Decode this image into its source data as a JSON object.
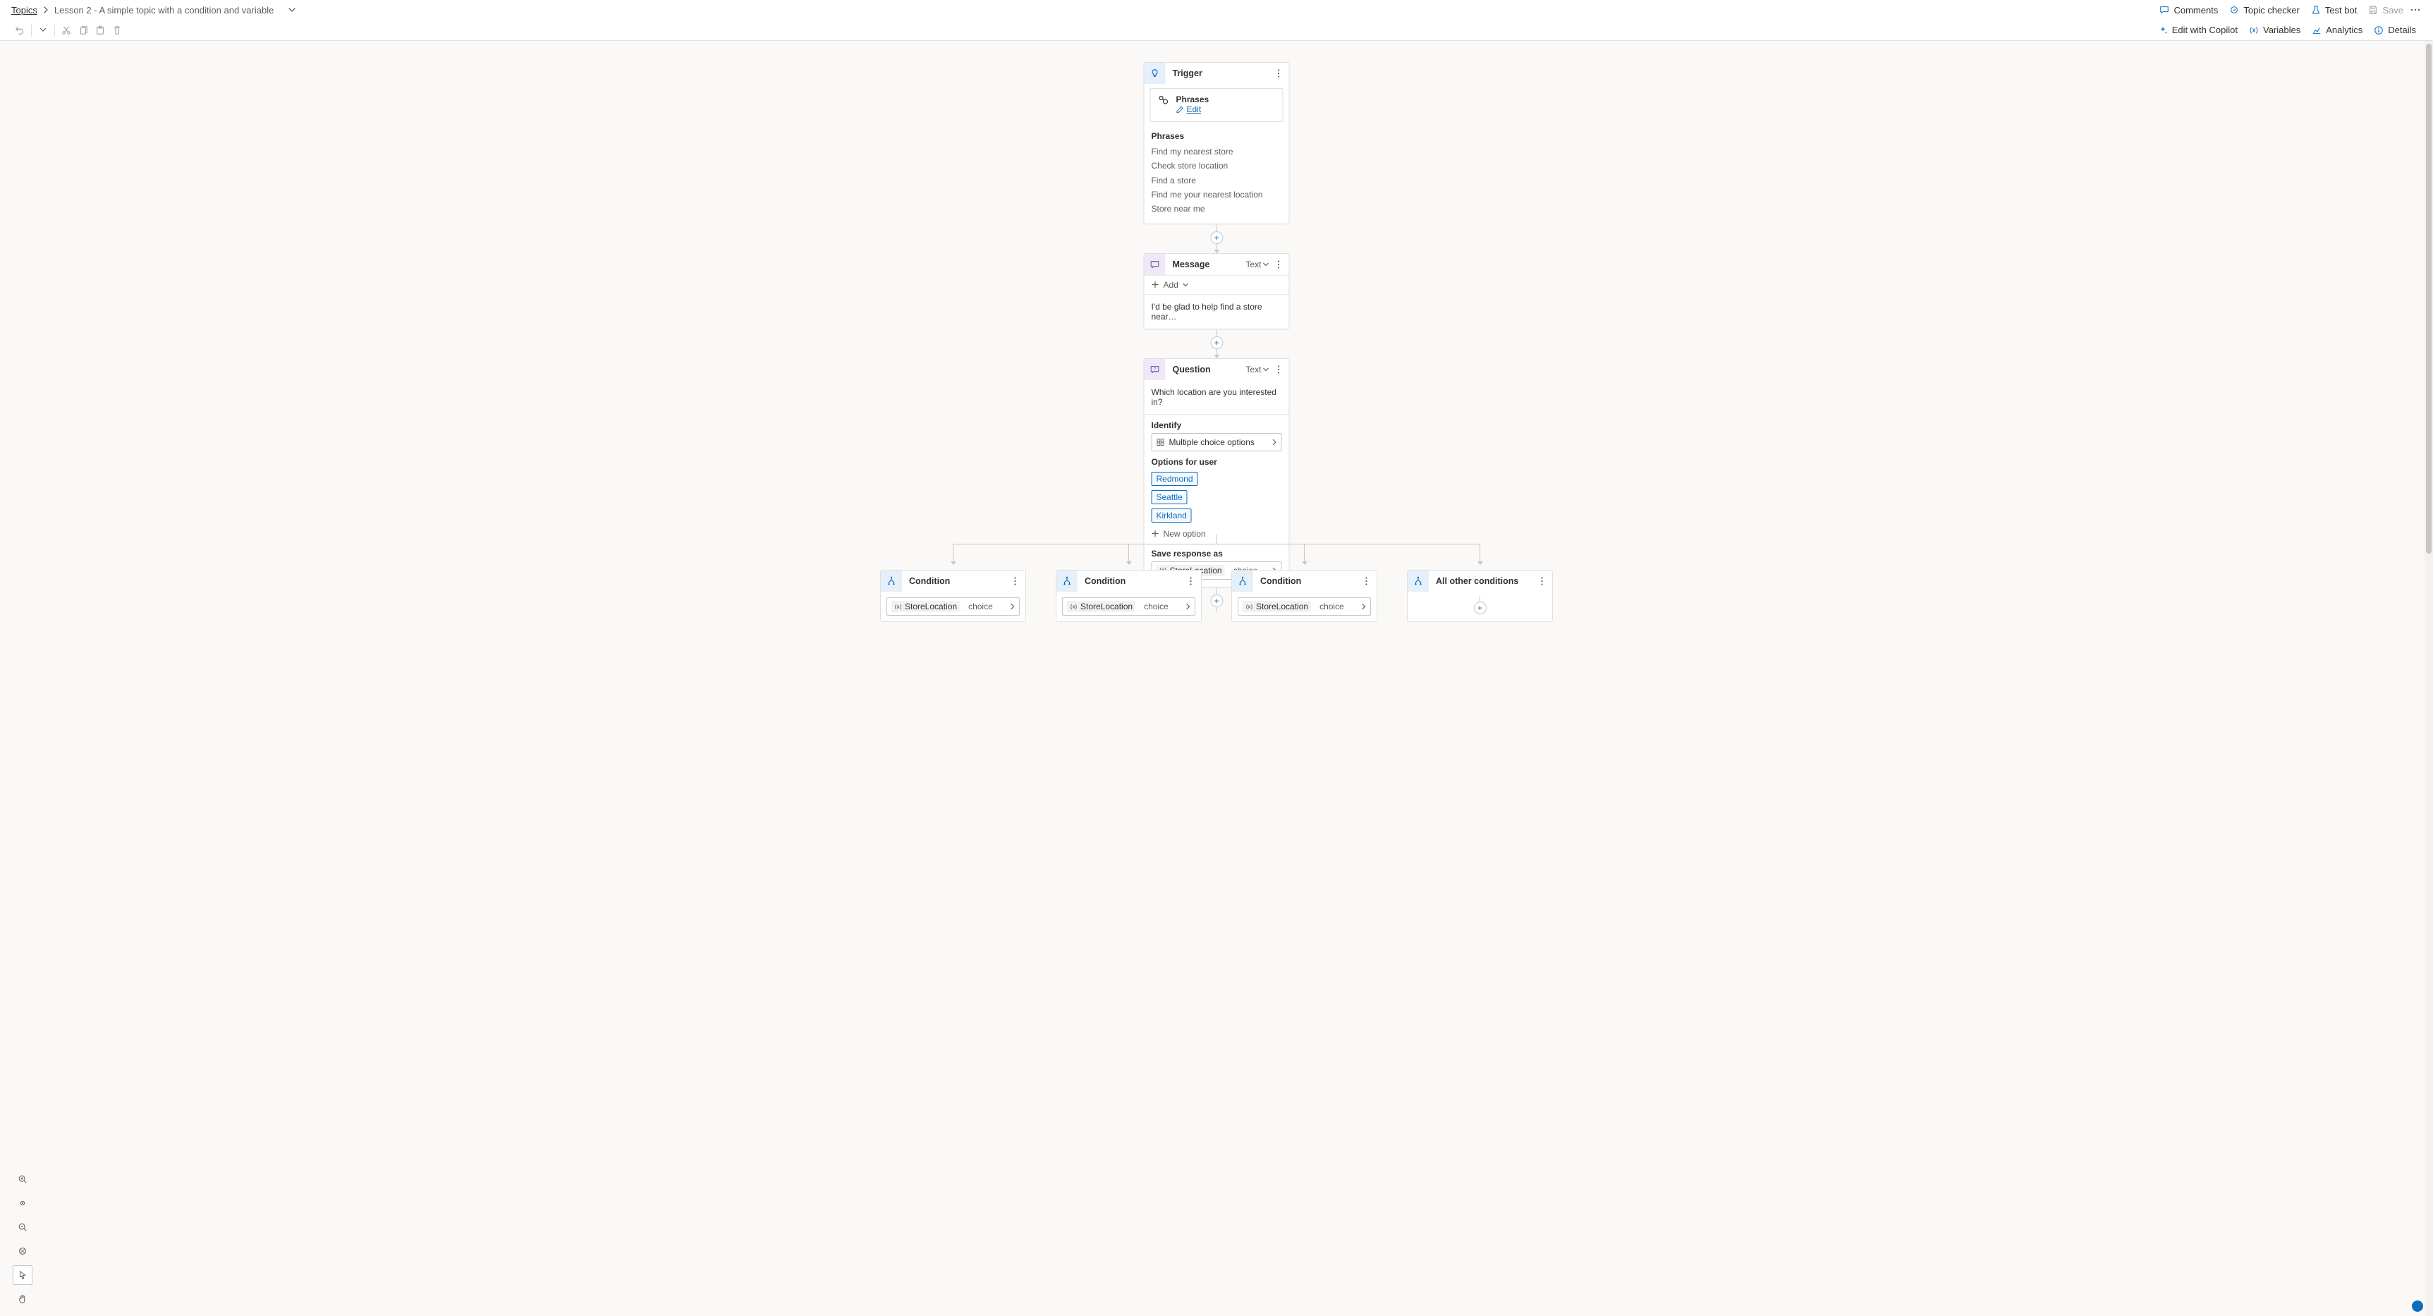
{
  "breadcrumb": {
    "root": "Topics",
    "title": "Lesson 2 - A simple topic with a condition and variable"
  },
  "topbar": {
    "comments": "Comments",
    "topic_checker": "Topic checker",
    "test_bot": "Test bot",
    "save": "Save"
  },
  "toolbar2": {
    "edit_copilot": "Edit with Copilot",
    "variables": "Variables",
    "analytics": "Analytics",
    "details": "Details"
  },
  "trigger": {
    "title": "Trigger",
    "phrases_label": "Phrases",
    "edit": "Edit",
    "phrases_header": "Phrases",
    "phrases": [
      "Find my nearest store",
      "Check store location",
      "Find a store",
      "Find me your nearest location",
      "Store near me"
    ]
  },
  "message": {
    "title": "Message",
    "variant": "Text",
    "add": "Add",
    "body": "I'd be glad to help find a store near…"
  },
  "question": {
    "title": "Question",
    "variant": "Text",
    "body": "Which location are you interested in?",
    "identify_label": "Identify",
    "identify_value": "Multiple choice options",
    "options_label": "Options for user",
    "options": [
      "Redmond",
      "Seattle",
      "Kirkland"
    ],
    "new_option": "New option",
    "save_as_label": "Save response as",
    "var_name": "StoreLocation",
    "var_type": "choice"
  },
  "branches": {
    "cond_title": "Condition",
    "other_title": "All other conditions",
    "var_name": "StoreLocation",
    "var_type": "choice"
  }
}
